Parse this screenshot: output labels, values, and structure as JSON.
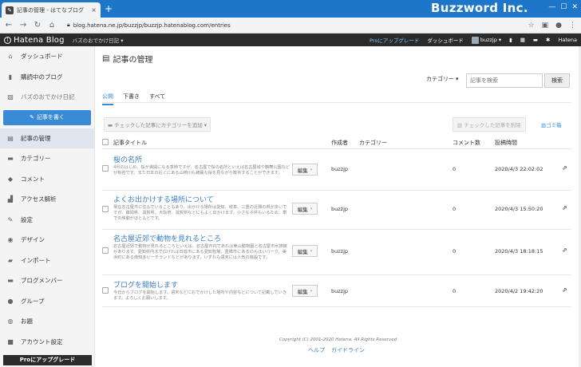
{
  "browser": {
    "tab_title": "記事の管理 - はてなブログ",
    "tab_close": "×",
    "new_tab": "+",
    "brand_watermark": "Buzzword Inc.",
    "url": "blog.hatena.ne.jp/buzzjp/buzzjp.hatenablog.com/entries"
  },
  "hatena_bar": {
    "logo": "Hatena Blog",
    "blog_menu": "バズのおでかけ日記 ▾",
    "pro_upgrade": "Proにアップグレード",
    "dashboard": "ダッシュボード",
    "user": "buzzjp",
    "hatena": "Hatena"
  },
  "sidebar": {
    "items_top": [
      {
        "label": "ダッシュボード",
        "icon": "home-icon",
        "glyph": "⌂"
      },
      {
        "label": "購読中のブログ",
        "icon": "bookmark-icon",
        "glyph": "▮"
      }
    ],
    "blog_name": "バズのおでかけ日記",
    "write_button": "記事を書く",
    "items": [
      {
        "label": "記事の管理",
        "icon": "document-icon",
        "glyph": "▤",
        "active": true
      },
      {
        "label": "カテゴリー",
        "icon": "folder-icon",
        "glyph": "▬"
      },
      {
        "label": "コメント",
        "icon": "comment-icon",
        "glyph": "◆"
      },
      {
        "label": "アクセス解析",
        "icon": "chart-icon",
        "glyph": "▟"
      },
      {
        "label": "設定",
        "icon": "wrench-icon",
        "glyph": "✎"
      },
      {
        "label": "デザイン",
        "icon": "palette-icon",
        "glyph": "◉"
      },
      {
        "label": "インポート",
        "icon": "import-icon",
        "glyph": "▰"
      },
      {
        "label": "ブログメンバー",
        "icon": "members-icon",
        "glyph": "▬"
      },
      {
        "label": "グループ",
        "icon": "group-icon",
        "glyph": "●"
      },
      {
        "label": "お題",
        "icon": "theme-icon",
        "glyph": "◍"
      },
      {
        "label": "アカウント設定",
        "icon": "account-icon",
        "glyph": "■"
      }
    ],
    "pro_button": "Proにアップグレード"
  },
  "main": {
    "title": "記事の管理",
    "category_select": "カテゴリー",
    "search_placeholder": "記事を検索",
    "search_button": "検索",
    "tabs": [
      {
        "label": "公開",
        "active": true
      },
      {
        "label": "下書き"
      },
      {
        "label": "すべて"
      }
    ],
    "bulk_category": "チェックした記事にカテゴリーを追加 ▾",
    "bulk_delete": "チェックした記事を削除",
    "trash": "ゴミ箱",
    "columns": {
      "title": "記事タイトル",
      "author": "作成者",
      "category": "カテゴリー",
      "comments": "コメント数",
      "date": "投稿時間"
    },
    "entries": [
      {
        "title": "桜の名所",
        "excerpt": "4月のはじめ、桜が満開になる季節ですが、名古屋で桜の名所といえば名古屋城や鶴舞公園などが有名です。また日本の近くにある山崎川も綺麗な桜を見ながら散歩することができます。",
        "edit": "編集",
        "author": "buzzjp",
        "comments": "0",
        "date": "2020/4/3 22:02:02"
      },
      {
        "title": "よくお出かけする場所について",
        "excerpt": "現在名古屋市に住んでいることもあり、出かける場所は愛知、岐阜、三重の近隣の県が多いですが、静岡県、滋賀県、大阪府、滋賀県などにもよく出かけます。小さな子供もいるため、車での移動がほとんどです。",
        "edit": "編集",
        "author": "buzzjp",
        "comments": "0",
        "date": "2020/4/3 15:50:20"
      },
      {
        "title": "名古屋近郊で動物を見れるところ",
        "excerpt": "名古屋近郊で動物が見れるところといえば、名古屋市内であれば東山動物園と名古屋市水族館があります。愛知県内まで広げれば日進市にある愛知牧場、豊橋市にあるのんほいパーク、美浜町にある南知多ビーチランドなどがあります。いずれも週末には人気の施設です。",
        "edit": "編集",
        "author": "buzzjp",
        "comments": "0",
        "date": "2020/4/3 18:18:15"
      },
      {
        "title": "ブログを開始します",
        "excerpt": "今日からブログを開始します。週末などにおでかけした場所や内容などについて記載していきます。よろしくお願いします。",
        "edit": "編集",
        "author": "buzzjp",
        "comments": "0",
        "date": "2020/4/2 19:42:20"
      }
    ],
    "copyright": "Copyright (C) 2001-2020 Hatena. All Rights Reserved.",
    "footer_help": "ヘルプ",
    "footer_guideline": "ガイドライン"
  },
  "colors": {
    "chrome_blue": "#1e76c9",
    "hatena_bar": "#2b2b2b",
    "accent": "#3a8bd5"
  }
}
